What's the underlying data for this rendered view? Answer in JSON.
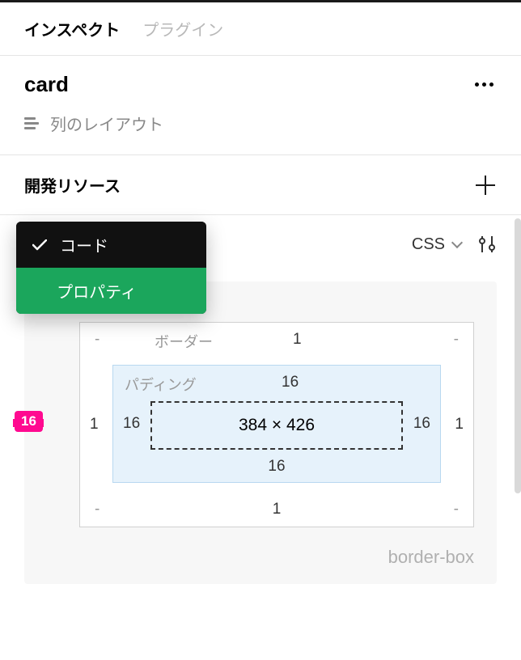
{
  "tabs": {
    "inspect": "インスペクト",
    "plugins": "プラグイン"
  },
  "layer": {
    "name": "card",
    "layout_label": "列のレイアウト"
  },
  "dev": {
    "title": "開発リソース"
  },
  "code": {
    "lang": "CSS",
    "dropdown": {
      "code": "コード",
      "properties": "プロパティ"
    }
  },
  "boxmodel": {
    "spacing_badge": "16",
    "border_label": "ボーダー",
    "padding_label": "パディング",
    "border": {
      "top": "1",
      "right": "1",
      "bottom": "1",
      "left": "1",
      "tl": "-",
      "tr": "-",
      "bl": "-",
      "br": "-"
    },
    "padding": {
      "top": "16",
      "right": "16",
      "bottom": "16",
      "left": "16"
    },
    "dimensions": "384 × 426",
    "box_sizing": "border-box"
  }
}
